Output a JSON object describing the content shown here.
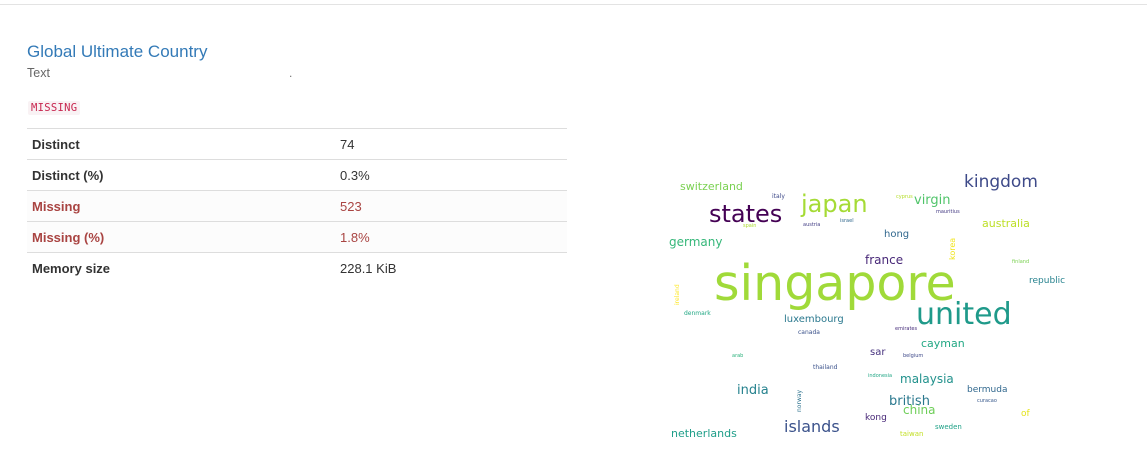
{
  "variable": {
    "name": "Global Ultimate Country",
    "type": "Text",
    "dot": ".",
    "warning_badge": "MISSING"
  },
  "stats": [
    {
      "label": "Distinct",
      "value": "74",
      "alert": false
    },
    {
      "label": "Distinct (%)",
      "value": "0.3%",
      "alert": false
    },
    {
      "label": "Missing",
      "value": "523",
      "alert": true
    },
    {
      "label": "Missing (%)",
      "value": "1.8%",
      "alert": true
    },
    {
      "label": "Memory size",
      "value": "228.1 KiB",
      "alert": false
    }
  ],
  "wordcloud": {
    "words": [
      {
        "text": "singapore",
        "color": "#a0da39"
      },
      {
        "text": "united",
        "color": "#1f9a8a"
      },
      {
        "text": "states",
        "color": "#440154"
      },
      {
        "text": "japan",
        "color": "#a5db36"
      },
      {
        "text": "kingdom",
        "color": "#3e4a89"
      },
      {
        "text": "virgin",
        "color": "#50c46a"
      },
      {
        "text": "switzerland",
        "color": "#7ad151"
      },
      {
        "text": "germany",
        "color": "#35b779"
      },
      {
        "text": "australia",
        "color": "#bddf26"
      },
      {
        "text": "france",
        "color": "#482878"
      },
      {
        "text": "hong",
        "color": "#31688e"
      },
      {
        "text": "republic",
        "color": "#26828e"
      },
      {
        "text": "luxembourg",
        "color": "#2a788e"
      },
      {
        "text": "cayman",
        "color": "#22a884"
      },
      {
        "text": "malaysia",
        "color": "#21918c"
      },
      {
        "text": "india",
        "color": "#26828e"
      },
      {
        "text": "british",
        "color": "#2a788e"
      },
      {
        "text": "china",
        "color": "#6ece58"
      },
      {
        "text": "islands",
        "color": "#3b528b"
      },
      {
        "text": "netherlands",
        "color": "#1f9e89"
      },
      {
        "text": "bermuda",
        "color": "#31688e"
      },
      {
        "text": "sar",
        "color": "#46327e"
      },
      {
        "text": "kong",
        "color": "#482878"
      },
      {
        "text": "sweden",
        "color": "#1fa187"
      },
      {
        "text": "taiwan",
        "color": "#c2df23"
      },
      {
        "text": "thailand",
        "color": "#3b528b"
      },
      {
        "text": "denmark",
        "color": "#22a884"
      },
      {
        "text": "canada",
        "color": "#3b528b"
      },
      {
        "text": "emirates",
        "color": "#472d7b"
      },
      {
        "text": "mauritius",
        "color": "#443a83"
      },
      {
        "text": "italy",
        "color": "#3e4a89"
      },
      {
        "text": "austria",
        "color": "#433e85"
      },
      {
        "text": "israel",
        "color": "#31688e"
      },
      {
        "text": "cyprus",
        "color": "#b5de2b"
      },
      {
        "text": "spain",
        "color": "#addc30"
      },
      {
        "text": "finland",
        "color": "#7ad151"
      },
      {
        "text": "arab",
        "color": "#2db27d"
      },
      {
        "text": "belgium",
        "color": "#3e4989"
      },
      {
        "text": "indonesia",
        "color": "#21a685"
      },
      {
        "text": "curacao",
        "color": "#38598c"
      },
      {
        "text": "of",
        "color": "#e5e419"
      },
      {
        "text": "korea",
        "color": "#f1e51d"
      },
      {
        "text": "ireland",
        "color": "#fde725"
      },
      {
        "text": "norway",
        "color": "#2c728e"
      }
    ]
  }
}
